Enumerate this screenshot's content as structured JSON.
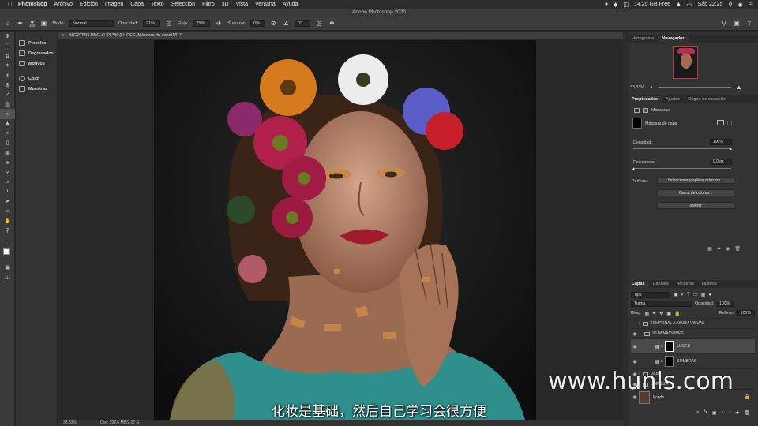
{
  "menubar": {
    "app_name": "Photoshop",
    "items": [
      "Archivo",
      "Edición",
      "Imagen",
      "Capa",
      "Texto",
      "Selección",
      "Filtro",
      "3D",
      "Vista",
      "Ventana",
      "Ayuda"
    ],
    "free_space": "14,25 GB Free",
    "clock": "Sáb 22:25"
  },
  "window": {
    "title": "Adobe Photoshop 2020"
  },
  "options_bar": {
    "brush_size": "400",
    "mode_label": "Modo:",
    "mode_value": "Normal",
    "opacity_label": "Opacidad:",
    "opacity_value": "21%",
    "flow_label": "Flujo:",
    "flow_value": "75%",
    "smooth_label": "Suavizar:",
    "smooth_value": "0%",
    "angle_value": "0°"
  },
  "side_panel": {
    "items": [
      {
        "label": "Pinceles"
      },
      {
        "label": "Degradados"
      },
      {
        "label": "Motivos"
      },
      {
        "label": "Color"
      },
      {
        "label": "Muestras"
      }
    ]
  },
  "document": {
    "tab_title": "IMGP7893.DNG al 33,3% (LUCES, Máscara de capa/16) *"
  },
  "status": {
    "zoom": "33,33%",
    "doc_info": "Doc: 292,6 MB/2,07 G"
  },
  "navigator": {
    "tabs": [
      "Histograma",
      "Navegador"
    ],
    "zoom": "33,33%"
  },
  "properties": {
    "tabs": [
      "Propiedades",
      "Ajustes",
      "Origen de clonación"
    ],
    "masks_label": "Máscaras",
    "layer_mask_label": "Máscara de capa",
    "density_label": "Densidad:",
    "density_value": "100%",
    "feather_label": "Desvanecer:",
    "feather_value": "0,0 px",
    "refine_label": "Perfecc.:",
    "buttons": [
      "Seleccionar y aplicar máscara...",
      "Gama de colores...",
      "Invertir"
    ]
  },
  "layers_panel": {
    "tabs": [
      "Capas",
      "Canales",
      "Acciones",
      "Historia"
    ],
    "filter_label": "Tipo",
    "blend_mode": "Trama",
    "opacity_label": "Opacidad:",
    "opacity_value": "100%",
    "lock_label": "Bloq.:",
    "fill_label": "Relleno:",
    "fill_value": "100%",
    "layers": [
      {
        "name": "TEMPORAL // AYUDA VISUAL",
        "kind": "group"
      },
      {
        "name": "ILUMINACIONES",
        "kind": "group"
      },
      {
        "name": "LUCES",
        "kind": "curves"
      },
      {
        "name": "SOMBRAS",
        "kind": "curves"
      },
      {
        "name": "D&B",
        "kind": "group"
      },
      {
        "name": "LIMPIEZA",
        "kind": "group"
      },
      {
        "name": "Fondo",
        "kind": "image"
      }
    ]
  },
  "overlay": {
    "subtitle": "化妆是基础，然后自己学习会很方便",
    "watermark": "www.hunls.com"
  },
  "colors": {
    "ui_dark": "#282828",
    "panel": "#333333",
    "accent_selected": "#4a4a4a"
  }
}
